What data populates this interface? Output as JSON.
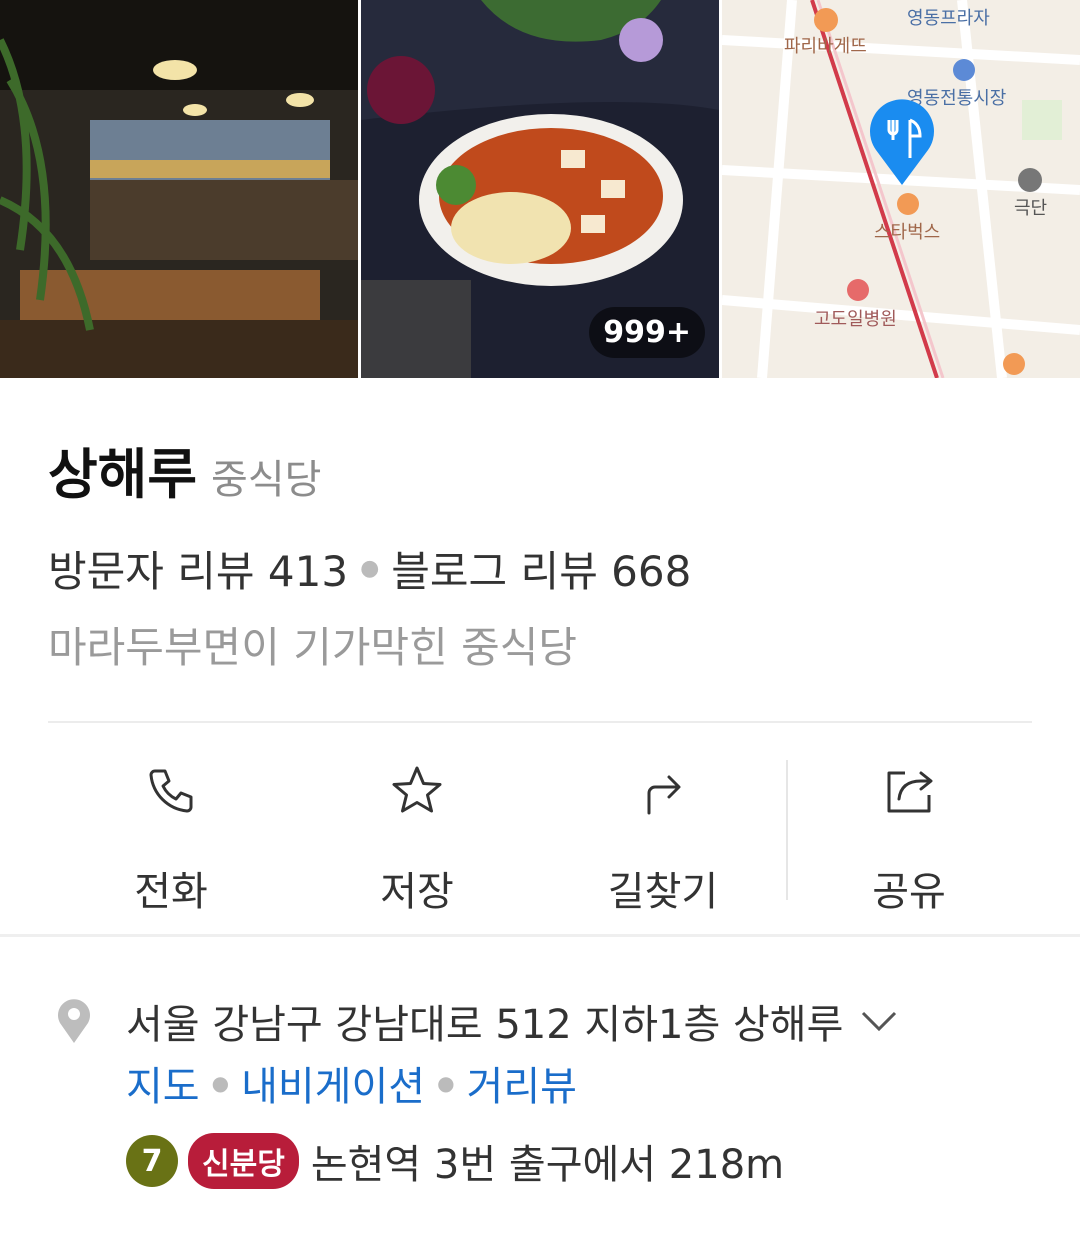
{
  "photos": {
    "count_label": "999+",
    "map_labels": {
      "plaza": "영동프라자",
      "bakery": "파리바게뜨",
      "market": "영동전통시장",
      "starbucks": "스타벅스",
      "theater": "극단",
      "hospital": "고도일병원"
    }
  },
  "place": {
    "name": "상해루",
    "category": "중식당",
    "visitor_reviews": "방문자 리뷰 413",
    "blog_reviews": "블로그 리뷰 668",
    "tagline": "마라두부면이 기가막힌 중식당"
  },
  "actions": [
    {
      "label": "전화",
      "icon": "phone-icon"
    },
    {
      "label": "저장",
      "icon": "star-icon"
    },
    {
      "label": "길찾기",
      "icon": "directions-icon"
    },
    {
      "label": "공유",
      "icon": "share-icon"
    }
  ],
  "address": {
    "text": "서울 강남구 강남대로 512 지하1층 상해루",
    "links": [
      "지도",
      "내비게이션",
      "거리뷰"
    ]
  },
  "subway": {
    "line_number": "7",
    "line_station": "신분당",
    "text": "논현역 3번 출구에서 218m"
  },
  "colors": {
    "link": "#1a6dca",
    "line7": "#697215",
    "shinbundang": "#b81d3a",
    "pin": "#1a8cf0"
  }
}
